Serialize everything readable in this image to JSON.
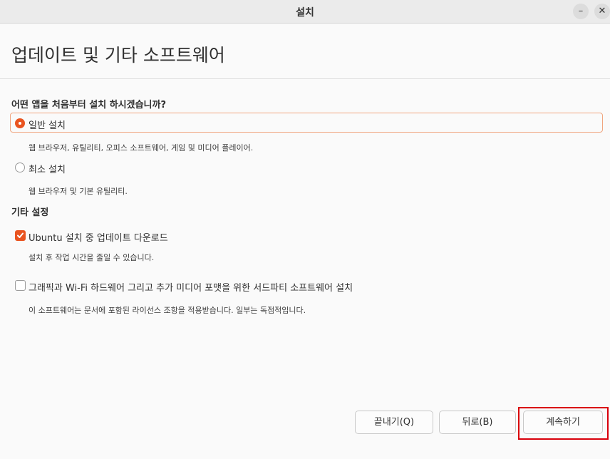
{
  "window": {
    "title": "설치",
    "minimize_glyph": "–",
    "close_glyph": "✕"
  },
  "page": {
    "title": "업데이트 및 기타 소프트웨어"
  },
  "install_type": {
    "question": "어떤 앱을 처음부터 설치 하시겠습니까?",
    "options": [
      {
        "label": "일반 설치",
        "description": "웹 브라우저, 유틸리티, 오피스  소프트웨어, 게임 및 미디어 플레이어.",
        "selected": true
      },
      {
        "label": "최소 설치",
        "description": "웹 브라우저 및 기본 유틸리티.",
        "selected": false
      }
    ]
  },
  "other": {
    "heading": "기타 설정",
    "options": [
      {
        "label": "Ubuntu 설치 중 업데이트 다운로드",
        "description": "설치 후 작업 시간을 줄일 수 있습니다.",
        "checked": true
      },
      {
        "label": "그래픽과 Wi-Fi 하드웨어 그리고 추가 미디어 포맷을 위한 서드파티 소프트웨어 설치",
        "description": "이 소프트웨어는 문서에 포함된 라이선스 조항을 적용받습니다. 일부는 독점적입니다.",
        "checked": false
      }
    ]
  },
  "buttons": {
    "quit": "끝내기(Q)",
    "back": "뒤로(B)",
    "continue": "계속하기"
  },
  "colors": {
    "accent": "#e95420",
    "highlight_border": "#d9000b"
  }
}
